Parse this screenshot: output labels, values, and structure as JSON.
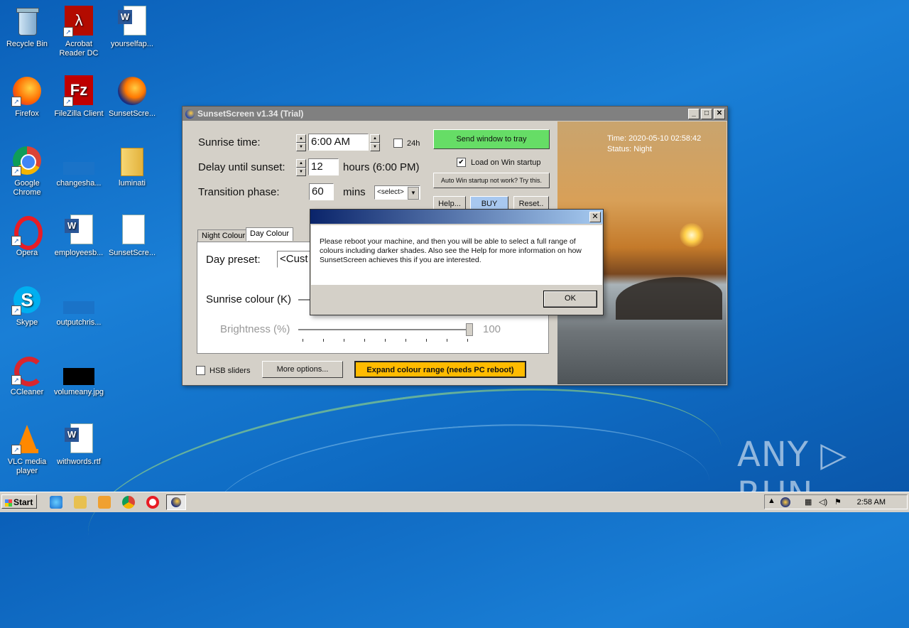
{
  "desktop": {
    "icons": [
      {
        "label": "Recycle Bin"
      },
      {
        "label": "Acrobat Reader DC"
      },
      {
        "label": "yourselfap..."
      },
      {
        "label": "Firefox"
      },
      {
        "label": "FileZilla Client"
      },
      {
        "label": "SunsetScre..."
      },
      {
        "label": "Google Chrome"
      },
      {
        "label": "changesha..."
      },
      {
        "label": "luminati"
      },
      {
        "label": "Opera"
      },
      {
        "label": "employeesb..."
      },
      {
        "label": "SunsetScre..."
      },
      {
        "label": "Skype"
      },
      {
        "label": "outputchris..."
      },
      {
        "label": "CCleaner"
      },
      {
        "label": "volumeany.jpg"
      },
      {
        "label": "VLC media player"
      },
      {
        "label": "withwords.rtf"
      }
    ]
  },
  "window": {
    "title": "SunsetScreen v1.34 (Trial)",
    "sunrise_label": "Sunrise time:",
    "sunrise_value": "6:00 AM",
    "h24_label": "24h",
    "delay_label": "Delay until sunset:",
    "delay_value": "12",
    "delay_unit": "hours  (6:00 PM)",
    "transition_label": "Transition phase:",
    "transition_value": "60",
    "transition_unit": "mins",
    "transition_select": "<select>",
    "send_tray": "Send window to tray",
    "load_startup": "Load on Win startup",
    "auto_startup": "Auto Win startup not work? Try this.",
    "help": "Help...",
    "buy": "BUY",
    "reset": "Reset..",
    "tabs": [
      "Night Colour",
      "Day Colour"
    ],
    "day_preset_label": "Day preset:",
    "day_preset_value": "<Cust",
    "sunrise_colour_label": "Sunrise colour (K)",
    "brightness_label": "Brightness (%)",
    "brightness_value": "100",
    "hsb_label": "HSB sliders",
    "more_options": "More options...",
    "expand": "Expand colour range (needs PC reboot)",
    "photo_time": "Time: 2020-05-10 02:58:42",
    "photo_status": "Status: Night"
  },
  "dialog": {
    "message": "Please reboot your machine, and then you will be able to select a full range of colours including darker shades. Also see the Help for more information on how SunsetScreen achieves this if you are interested.",
    "ok": "OK"
  },
  "taskbar": {
    "start": "Start",
    "clock": "2:58 AM"
  },
  "watermark": "ANY ▷ RUN",
  "colors": {
    "send_tray_bg": "#66dd66",
    "expand_bg": "#ffbb00",
    "buy_bg": "#a8c8f0"
  }
}
